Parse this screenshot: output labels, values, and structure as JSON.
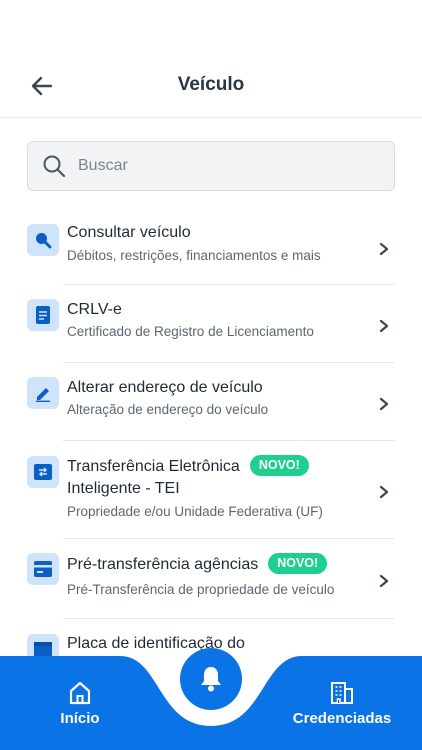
{
  "header": {
    "title": "Veículo",
    "back_icon": "arrow-left-icon"
  },
  "search": {
    "placeholder": "Buscar",
    "value": ""
  },
  "items": [
    {
      "title": "Consultar veículo",
      "subtitle": "Débitos, restrições, financiamentos e mais",
      "icon": "search-icon"
    },
    {
      "title": "CRLV-e",
      "subtitle": "Certificado de Registro de Licenciamento",
      "icon": "document-icon"
    },
    {
      "title": "Alterar endereço de veículo",
      "subtitle": "Alteração de endereço do veículo",
      "icon": "edit-icon"
    },
    {
      "title_line1": "Transferência Eletrônica",
      "title_line2": "Inteligente - TEI",
      "subtitle": "Propriedade e/ou Unidade Federativa (UF)",
      "badge": "NOVO!",
      "icon": "transfer-icon"
    },
    {
      "title": "Pré-transferência agências",
      "subtitle": "Pré-Transferência de propriedade de veículo",
      "badge": "NOVO!",
      "icon": "card-icon"
    },
    {
      "title": "Placa de identificação do",
      "subtitle": "",
      "icon": "plate-icon"
    }
  ],
  "bottom_nav": {
    "home_label": "Início",
    "accredited_label": "Credenciadas",
    "center_icon": "bell-icon"
  },
  "colors": {
    "primary": "#0a73e6",
    "icon_bg": "#cfe3fb",
    "badge": "#1ecf8f",
    "text": "#1f2a36",
    "muted": "#5c6773"
  }
}
